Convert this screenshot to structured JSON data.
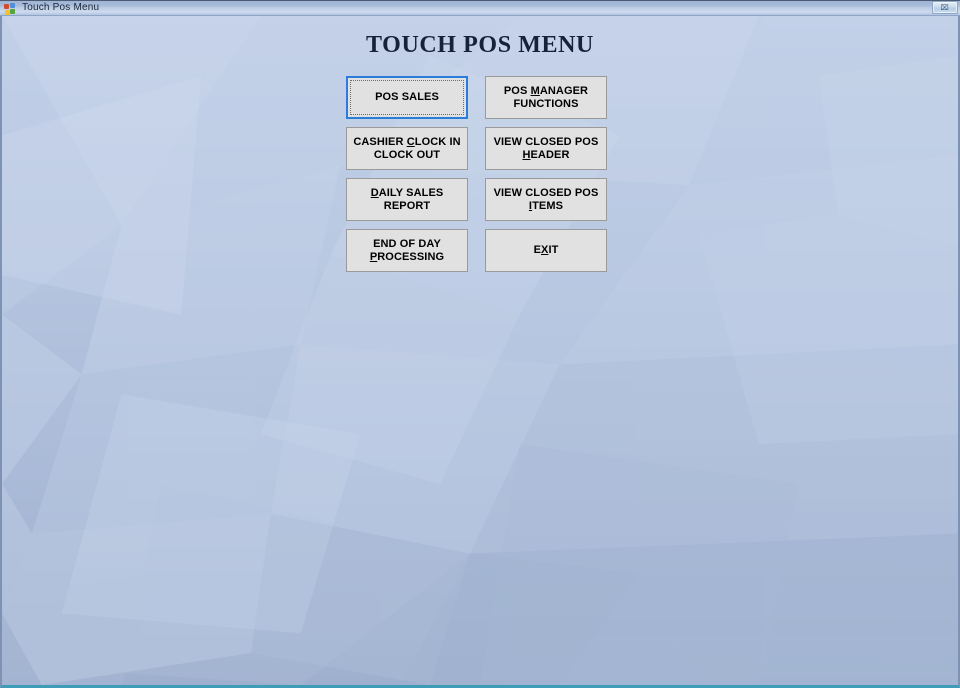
{
  "window": {
    "title": "Touch Pos Menu",
    "icon": "windows-app-icon",
    "close_glyph": "⌧",
    "close_name": "close-window-button"
  },
  "page": {
    "title": "TOUCH POS MENU"
  },
  "colors": {
    "accent_focus": "#2b7ddb",
    "button_face": "#e1e1e1",
    "button_border": "#9a9a9a",
    "bottom_border": "#3e9cb8",
    "side_border": "#7e93b4",
    "title_text": "#16213a",
    "wallpaper_top": "#c3d0e8",
    "wallpaper_bottom": "#9eb0cd"
  },
  "menu": {
    "rows": [
      [
        {
          "id": "pos-sales",
          "name": "pos-sales-button",
          "label": "POS SALES",
          "pre": "POS SALES",
          "accel": "",
          "post": "",
          "focused": true
        },
        {
          "id": "pos-manager-functions",
          "name": "pos-manager-functions-button",
          "label": "POS MANAGER\nFUNCTIONS",
          "pre": "POS ",
          "accel": "M",
          "post": "ANAGER\nFUNCTIONS",
          "focused": false
        }
      ],
      [
        {
          "id": "cashier-clock-in-clock-out",
          "name": "cashier-clock-in-clock-out-button",
          "label": "CASHIER CLOCK IN\nCLOCK OUT",
          "pre": "CASHIER ",
          "accel": "C",
          "post": "LOCK IN\nCLOCK OUT",
          "focused": false
        },
        {
          "id": "view-closed-pos-header",
          "name": "view-closed-pos-header-button",
          "label": "VIEW CLOSED POS\nHEADER",
          "pre": "VIEW CLOSED POS\n",
          "accel": "H",
          "post": "EADER",
          "focused": false
        }
      ],
      [
        {
          "id": "daily-sales-report",
          "name": "daily-sales-report-button",
          "label": "DAILY  SALES\nREPORT",
          "pre": "",
          "accel": "D",
          "post": "AILY  SALES\nREPORT",
          "focused": false
        },
        {
          "id": "view-closed-pos-items",
          "name": "view-closed-pos-items-button",
          "label": "VIEW CLOSED POS\nITEMS",
          "pre": "VIEW CLOSED POS\n",
          "accel": "I",
          "post": "TEMS",
          "focused": false
        }
      ],
      [
        {
          "id": "end-of-day-processing",
          "name": "end-of-day-processing-button",
          "label": "END OF DAY\nPROCESSING",
          "pre": "END OF DAY\n",
          "accel": "P",
          "post": "ROCESSING",
          "focused": false
        },
        {
          "id": "exit",
          "name": "exit-button",
          "label": "EXIT",
          "pre": "E",
          "accel": "X",
          "post": "IT",
          "focused": false
        }
      ]
    ]
  }
}
